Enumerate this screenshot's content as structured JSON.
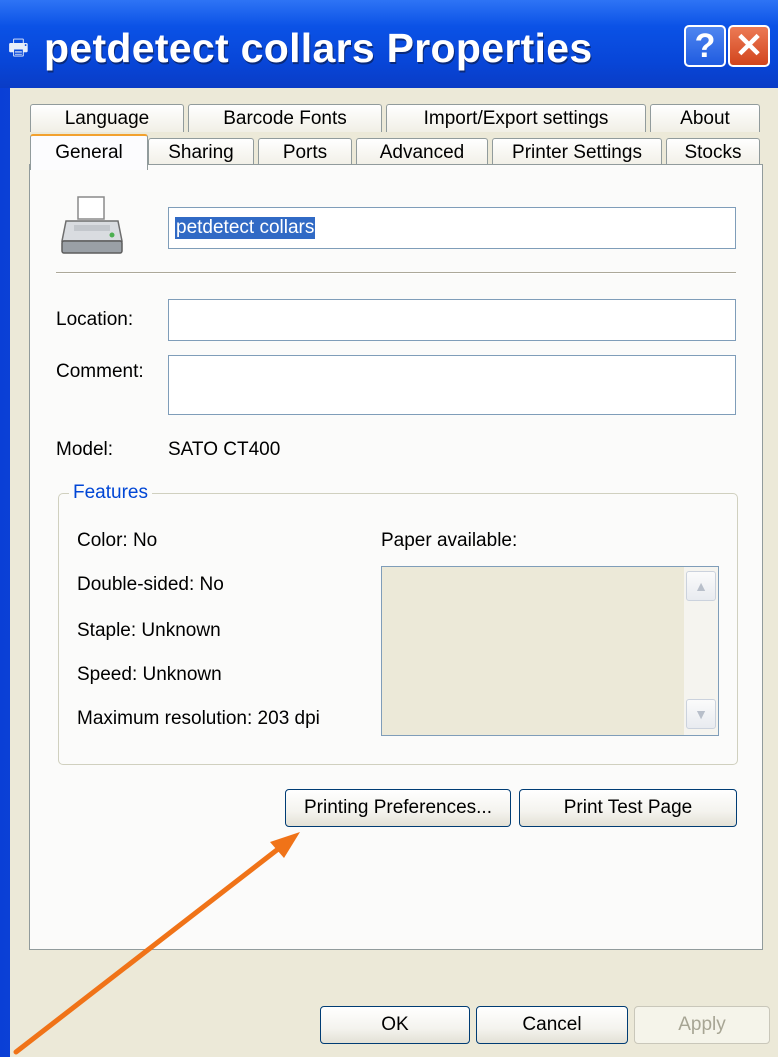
{
  "window": {
    "title": "petdetect collars Properties",
    "help_symbol": "?",
    "close_symbol": "✕"
  },
  "tabs": {
    "back_row": [
      "Language",
      "Barcode Fonts",
      "Import/Export settings",
      "About"
    ],
    "front_row": [
      "General",
      "Sharing",
      "Ports",
      "Advanced",
      "Printer Settings",
      "Stocks"
    ],
    "active": "General"
  },
  "general": {
    "printer_name": "petdetect collars",
    "location_label": "Location:",
    "location_value": "",
    "comment_label": "Comment:",
    "comment_value": "",
    "model_label": "Model:",
    "model_value": "SATO CT400"
  },
  "features": {
    "title": "Features",
    "color": "Color: No",
    "double_sided": "Double-sided: No",
    "staple": "Staple: Unknown",
    "speed": "Speed: Unknown",
    "max_resolution": "Maximum resolution: 203 dpi",
    "paper_label": "Paper available:"
  },
  "buttons": {
    "printing_preferences": "Printing Preferences...",
    "print_test_page": "Print Test Page",
    "ok": "OK",
    "cancel": "Cancel",
    "apply": "Apply"
  },
  "colors": {
    "titlebar": "#0b52e6",
    "dialog_bg": "#ece9d8",
    "tab_highlight": "#f2a12e",
    "selection": "#316ac5",
    "arrow": "#f07318"
  }
}
